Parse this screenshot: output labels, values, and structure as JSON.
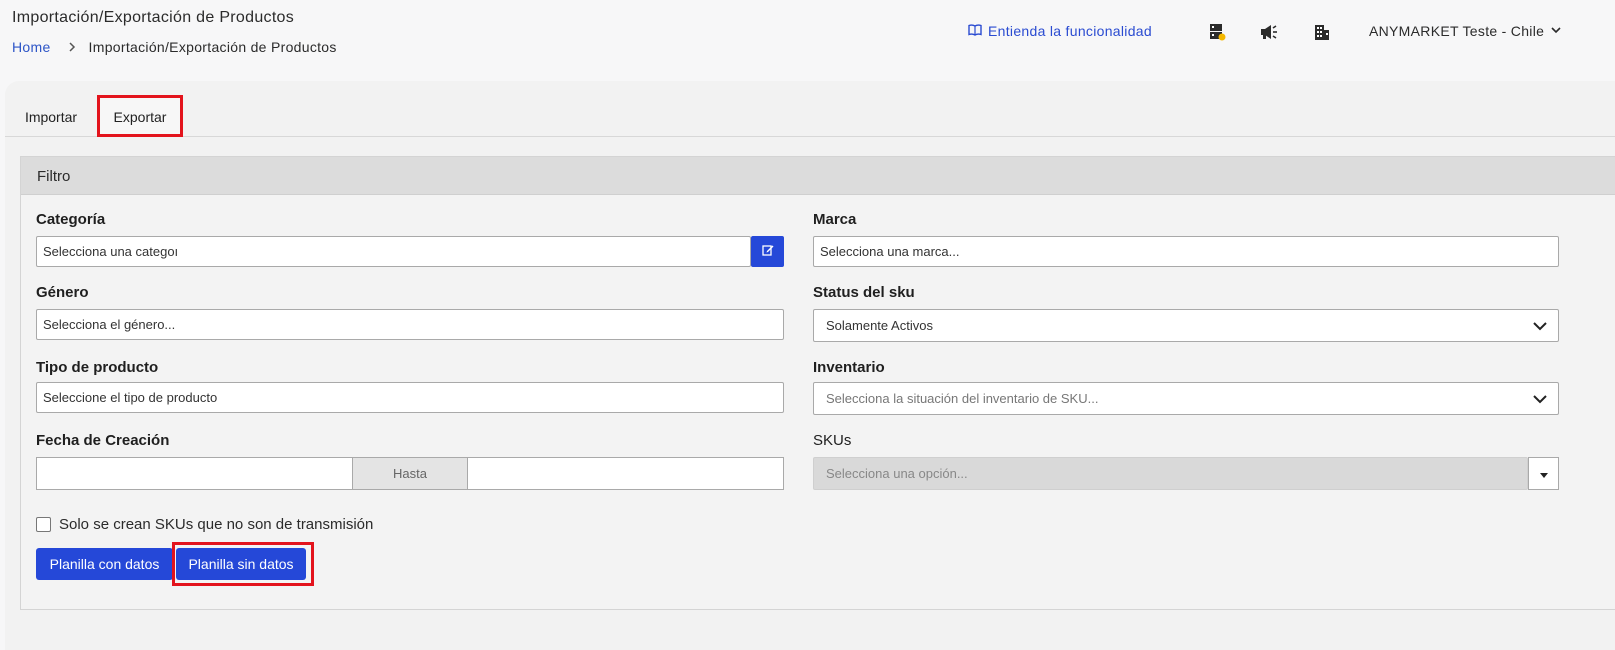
{
  "header": {
    "title": "Importación/Exportación de Productos",
    "breadcrumb": {
      "home": "Home",
      "current": "Importación/Exportación de Productos"
    },
    "help_link": "Entienda la funcionalidad",
    "icons": [
      "server-alert-icon",
      "megaphone-icon",
      "building-icon"
    ],
    "account": "ANYMARKET Teste - Chile"
  },
  "tabs": [
    {
      "label": "Importar",
      "active": false
    },
    {
      "label": "Exportar",
      "active": true
    }
  ],
  "filter": {
    "title": "Filtro",
    "categoria": {
      "label": "Categoría",
      "value": "Selecciona una categoı"
    },
    "marca": {
      "label": "Marca",
      "placeholder": "Selecciona una marca..."
    },
    "genero": {
      "label": "Género",
      "placeholder": "Selecciona el género..."
    },
    "status_sku": {
      "label": "Status del sku",
      "value": "Solamente Activos"
    },
    "tipo_producto": {
      "label": "Tipo de producto",
      "placeholder": "Seleccione el tipo de producto"
    },
    "inventario": {
      "label": "Inventario",
      "placeholder": "Selecciona la situación del inventario de SKU..."
    },
    "fecha_creacion": {
      "label": "Fecha de Creación",
      "from": "",
      "separator": "Hasta",
      "to": ""
    },
    "skus": {
      "label": "SKUs",
      "placeholder": "Selecciona una opción..."
    },
    "checkbox_label": "Solo se crean SKUs que no son de transmisión",
    "checkbox_checked": false
  },
  "buttons": {
    "with_data": "Planilla con datos",
    "without_data": "Planilla sin datos"
  },
  "colors": {
    "primary": "#2548d8",
    "link": "#2a4bd1",
    "highlight": "#e3131c",
    "notification_dot": "#f5b800"
  }
}
